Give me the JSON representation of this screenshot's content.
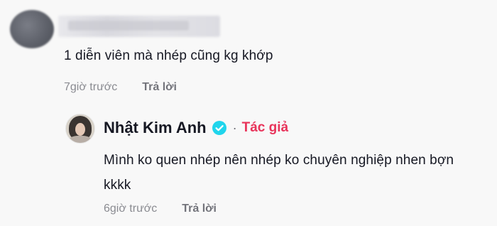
{
  "comments": [
    {
      "text": "1 diễn viên mà nhép cũng kg khớp",
      "time": "7giờ trước",
      "reply_label": "Trả lời"
    }
  ],
  "reply": {
    "author_name": "Nhật Kim Anh",
    "author_badge": "Tác giả",
    "separator": "·",
    "text": "Mình ko quen nhép nên nhép ko chuyên nghiệp nhen bợn kkkk",
    "time": "6giờ trước",
    "reply_label": "Trả lời",
    "verified_color": "#20d5ec",
    "badge_color": "#e8335a"
  }
}
